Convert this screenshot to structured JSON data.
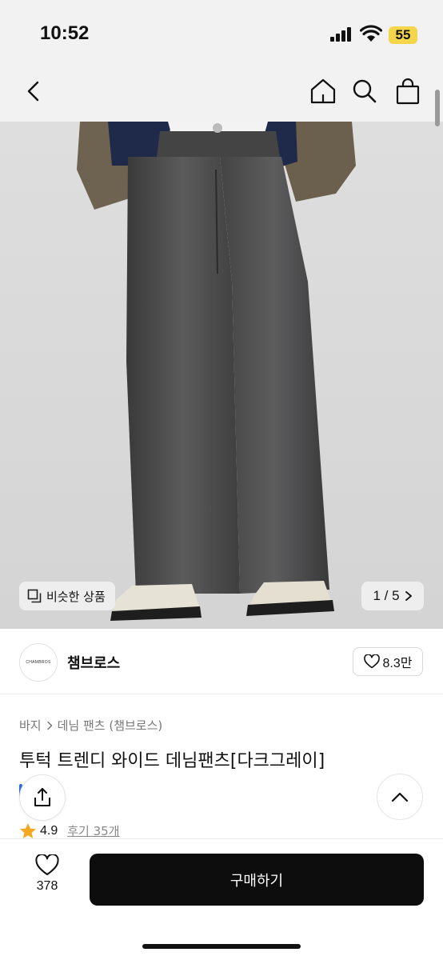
{
  "status": {
    "time": "10:52",
    "battery": "55"
  },
  "product": {
    "image_pager": "1 / 5",
    "similar_label": "비슷한 상품",
    "brand": {
      "name": "챔브로스",
      "logo_text": "CHAMBROS"
    },
    "likes_label": "8.3만",
    "breadcrumb": [
      "바지",
      "데님 팬츠 (챔브로스)"
    ],
    "title": "투턱 트렌디 와이드 데님팬츠[다크그레이]",
    "rating": "4.9",
    "reviews_label": "후기 35개"
  },
  "bottom": {
    "wish_count": "378",
    "buy_label": "구매하기"
  },
  "colors": {
    "buy_button": "#0d0d0d",
    "rating_star": "#f5a623",
    "battery": "#f5d64a"
  }
}
